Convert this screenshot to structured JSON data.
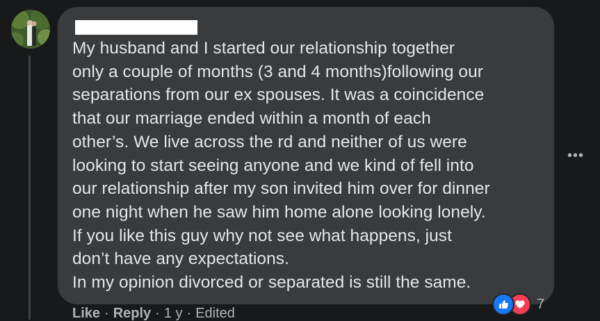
{
  "comment": {
    "lines": [
      "My husband and I started our relationship together",
      "only a couple of months (3 and 4 months)following our",
      "separations from our ex spouses. It was a coincidence",
      "that our marriage ended within a month of each",
      "other’s. We live across the rd and neither of us were",
      "looking to start seeing anyone and we kind of fell into",
      "our relationship after my son invited him over for dinner",
      "one night when he saw him home alone looking lonely.",
      "If you like this guy why not see what happens, just",
      "don’t have any expectations.",
      "In my opinion divorced or separated is still the same."
    ]
  },
  "actions": {
    "like": "Like",
    "reply": "Reply",
    "time": "1 y",
    "edited": "Edited",
    "separator": "·"
  },
  "more_button": "•••",
  "reactions": {
    "count": "7",
    "like_color": "#1877f2",
    "love_color": "#f33e58"
  }
}
